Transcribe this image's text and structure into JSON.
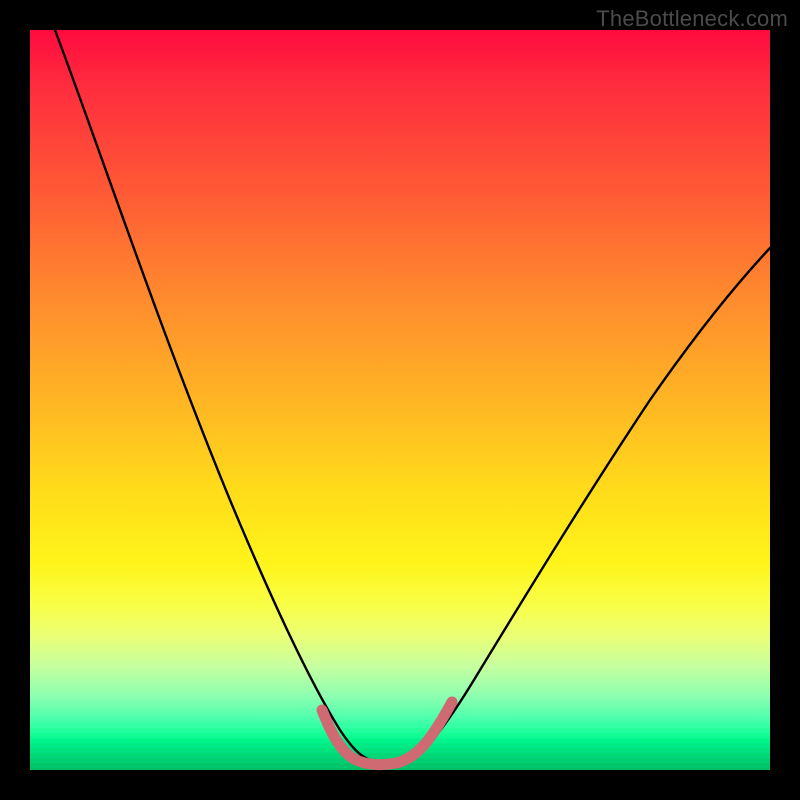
{
  "watermark": "TheBottleneck.com",
  "chart_data": {
    "type": "line",
    "title": "",
    "xlabel": "",
    "ylabel": "",
    "xlim": [
      0,
      100
    ],
    "ylim": [
      0,
      100
    ],
    "grid": false,
    "legend": false,
    "series": [
      {
        "name": "bottleneck-curve",
        "color": "#000000",
        "x": [
          0,
          5,
          10,
          15,
          20,
          25,
          30,
          35,
          38,
          40,
          42,
          44,
          46,
          48,
          50,
          55,
          60,
          65,
          70,
          75,
          80,
          85,
          90,
          95,
          100
        ],
        "y": [
          100,
          88,
          76,
          65,
          54,
          43,
          32,
          20,
          11,
          6,
          3,
          1.5,
          1,
          1,
          1.2,
          3,
          8,
          15,
          23,
          31,
          39,
          47,
          54,
          60,
          65
        ]
      },
      {
        "name": "optimal-zone-highlight",
        "color": "#cf6a72",
        "x": [
          38,
          40,
          42,
          44,
          46,
          48,
          50,
          52
        ],
        "y": [
          6,
          3,
          1.8,
          1.2,
          1.0,
          1.0,
          1.4,
          3.2
        ]
      }
    ],
    "annotations": []
  }
}
